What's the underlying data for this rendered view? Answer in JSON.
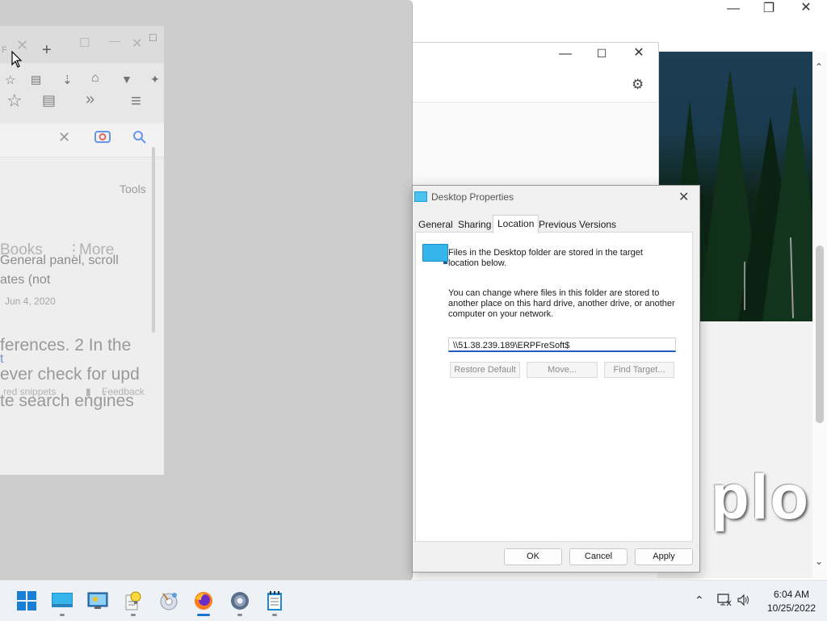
{
  "dialog": {
    "title": "Desktop Properties",
    "tabs": [
      "General",
      "Sharing",
      "Location",
      "Previous Versions"
    ],
    "active_tab": "Location",
    "info_text": "Files in the Desktop folder are stored in the target location below.",
    "change_text": "You can change where files in this folder are stored to another place on this hard drive, another drive, or another computer on your network.",
    "path_value": "\\\\51.38.239.189\\ERPFreSoft$",
    "restore_default": "Restore Default",
    "move": "Move...",
    "find_target": "Find Target...",
    "ok": "OK",
    "cancel": "Cancel",
    "apply": "Apply"
  },
  "ghost_browser": {
    "tools": "Tools",
    "books": "Books",
    "more": "More",
    "snippet_line1": "General panel, scroll",
    "snippet_line2": "ates (not",
    "date": "Jun 4, 2020",
    "result_line1": "ferences. 2 In the",
    "result_line2": "t",
    "result_line3": "ever check for upd",
    "result_line4": "te search engines",
    "featured": "red snippets",
    "feedback": "Feedback",
    "tab_fragment": "F"
  },
  "background_window": {
    "watermark": "plo"
  },
  "taskbar": {
    "time": "6:04 AM",
    "date": "10/25/2022"
  },
  "colors": {
    "accent": "#1f5fbf",
    "taskbar": "#eef2f6",
    "ghost_gray": "#cdcdcd"
  }
}
